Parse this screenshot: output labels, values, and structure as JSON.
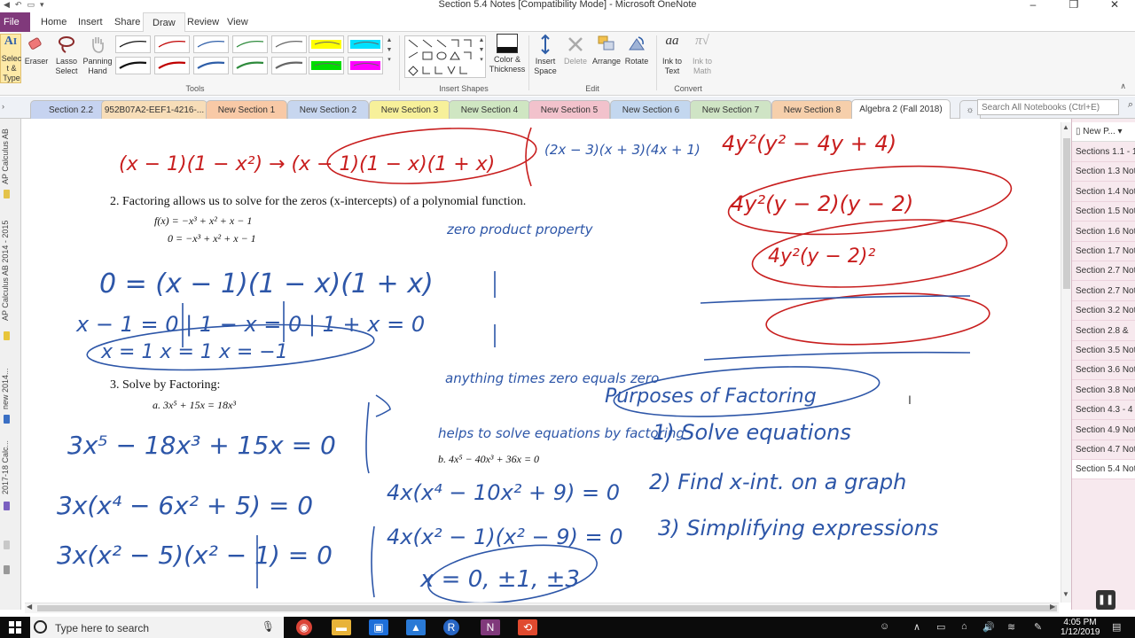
{
  "window": {
    "title": "Section 5.4 Notes [Compatibility Mode]  -  Microsoft OneNote",
    "minimize": "–",
    "maximize": "❐",
    "close": "✕"
  },
  "ribbon_tabs": [
    {
      "label": "File"
    },
    {
      "label": "Home"
    },
    {
      "label": "Insert"
    },
    {
      "label": "Share"
    },
    {
      "label": "Draw"
    },
    {
      "label": "Review"
    },
    {
      "label": "View"
    }
  ],
  "ribbon": {
    "select_type": "Select & Type",
    "eraser": "Eraser",
    "lasso": "Lasso Select",
    "panning": "Panning Hand",
    "tools_label": "Tools",
    "insert_shapes_label": "Insert Shapes",
    "color_thickness": "Color & Thickness",
    "insert_space": "Insert Space",
    "delete": "Delete",
    "arrange": "Arrange",
    "rotate": "Rotate",
    "edit_label": "Edit",
    "ink_to_text": "Ink to Text",
    "ink_to_math": "Ink to Math",
    "convert_label": "Convert"
  },
  "pens_row1": [
    "#111111",
    "#c00000",
    "#2e5ea8",
    "#2e8b3c",
    "#666666",
    "#ffff00",
    "#00e0ff"
  ],
  "pens_row2": [
    "#111111",
    "#c00000",
    "#2e5ea8",
    "#2e8b3c",
    "#666666",
    "#00dd00",
    "#ff00ff"
  ],
  "sections": [
    {
      "label": "Section 2.2",
      "color": "#c6d3f0"
    },
    {
      "label": "952B07A2-EEF1-4216-...",
      "color": "#f7ddb8"
    },
    {
      "label": "New Section 1",
      "color": "#f8c9a6"
    },
    {
      "label": "New Section 2",
      "color": "#c7d6ef"
    },
    {
      "label": "New Section 3",
      "color": "#f7f09a"
    },
    {
      "label": "New Section 4",
      "color": "#cfe6c2"
    },
    {
      "label": "New Section 5",
      "color": "#f2c2cc"
    },
    {
      "label": "New Section 6",
      "color": "#c3d7ef"
    },
    {
      "label": "New Section 7",
      "color": "#cfe4c5"
    },
    {
      "label": "New Section 8",
      "color": "#f6cfab"
    },
    {
      "label": "Algebra 2 (Fall 2018)",
      "color": "#ffffff"
    }
  ],
  "add_section": "☼",
  "search": {
    "placeholder": "Search All Notebooks (Ctrl+E)"
  },
  "notebooks": [
    "AP Calculus AB",
    "AP Calculus AB 2014 - 2015",
    "new 2014...",
    "2017-18 Calc..."
  ],
  "notes": {
    "item2": "2.  Factoring allows us to solve for the zeros (x-intercepts) of a polynomial function.",
    "eq_fx": "f(x) = −x³ + x² + x − 1",
    "eq_zero": "0 = −x³ + x² + x − 1",
    "item3": "3.  Solve by Factoring:",
    "part_a": "a.  3x⁵ + 15x = 18x³",
    "part_b": "b.  4x⁵ − 40x³ + 36x = 0"
  },
  "ink_text": {
    "zero_product": "zero product property",
    "anything_times_zero": "anything times zero equals zero",
    "purpose": "Purposes of Factoring",
    "p1": "1)  Solve equations",
    "p2": "2)  Find x-int. on a graph",
    "p3": "3)  Simplifying expressions",
    "helps": "helps to solve equations by factoring",
    "eq1": "0 = (x − 1)(1 − x)(1 + x)",
    "eq2": "x − 1 = 0 | 1 − x = 0 | 1 + x = 0",
    "eq3": "x = 1     x = 1     x = −1",
    "a1": "3x⁵ − 18x³ + 15x = 0",
    "a2": "3x(x⁴ − 6x² + 5) = 0",
    "a3": "3x(x² − 5)(x² − 1) = 0",
    "b1": "4x(x⁴ − 10x² + 9) = 0",
    "b2": "4x(x² − 1)(x² − 9) = 0",
    "b3": "x = 0, ±1, ±3",
    "top_left": "(x − 1)(1 − x²) → (x − 1)(1 − x)(1 + x)",
    "top_mid": "(2x − 3)(x + 3)(4x + 1)",
    "r1": "4y²(y² − 4y + 4)",
    "r2": "4y²(y − 2)(y − 2)",
    "r3": "4y²(y − 2)²"
  },
  "pages": {
    "new_page": "New P...",
    "items": [
      "Sections 1.1 - 1",
      "Section 1.3 Not",
      "Section 1.4 Not",
      "Section 1.5 Not",
      "Section 1.6 Not",
      "Section 1.7 Not",
      "Section 2.7 Not",
      "Section 2.7 Not",
      "Section 3.2 Not",
      "Section 2.8 &",
      "Section 3.5 Not",
      "Section 3.6 Not",
      "Section 3.8 Not",
      "Section 4.3 - 4",
      "Section 4.9 Not",
      "Section 4.7 Not",
      "Section 5.4 Not"
    ]
  },
  "taskbar": {
    "search_placeholder": "Type here to search",
    "time": "4:05 PM",
    "date": "1/12/2019"
  },
  "colors": {
    "file_tab": "#80397b",
    "ink_red": "#c81e1e",
    "ink_blue": "#2d56a8",
    "page_panel": "#f7e9ee"
  }
}
